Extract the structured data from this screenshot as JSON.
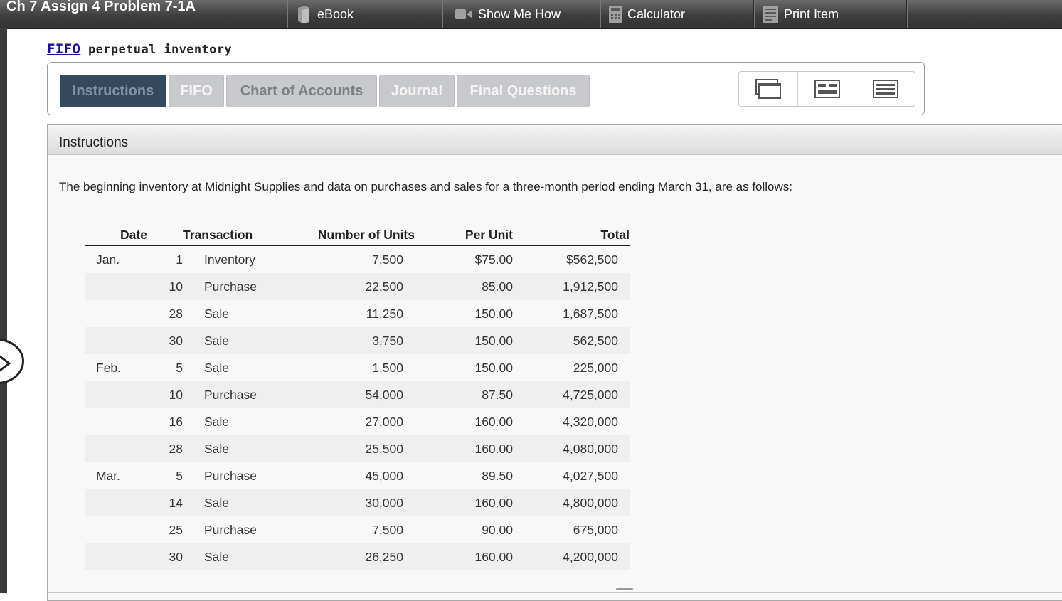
{
  "window": {
    "title": "Ch 7 Assign 4 Problem 7-1A"
  },
  "toolbar": {
    "ebook": "eBook",
    "show_me_how": "Show Me How",
    "calculator": "Calculator",
    "print_item": "Print Item"
  },
  "heading": {
    "link": "FIFO",
    "rest": " perpetual inventory"
  },
  "tabs": [
    {
      "label": "Instructions",
      "active": true
    },
    {
      "label": "FIFO"
    },
    {
      "label": "Chart of Accounts"
    },
    {
      "label": "Journal"
    },
    {
      "label": "Final Questions"
    }
  ],
  "view_buttons": [
    "single-window-icon",
    "split-view-icon",
    "list-view-icon"
  ],
  "panel": {
    "title": "Instructions",
    "intro": "The beginning inventory at Midnight Supplies and data on purchases and sales for a three-month period ending March 31, are as follows:"
  },
  "table": {
    "headers": {
      "date": "Date",
      "transaction": "Transaction",
      "units": "Number of Units",
      "per_unit": "Per Unit",
      "total": "Total"
    },
    "rows": [
      {
        "month": "Jan.",
        "day": "1",
        "transaction": "Inventory",
        "units": "7,500",
        "per_unit": "$75.00",
        "total": "$562,500"
      },
      {
        "month": "",
        "day": "10",
        "transaction": "Purchase",
        "units": "22,500",
        "per_unit": "85.00",
        "total": "1,912,500"
      },
      {
        "month": "",
        "day": "28",
        "transaction": "Sale",
        "units": "11,250",
        "per_unit": "150.00",
        "total": "1,687,500"
      },
      {
        "month": "",
        "day": "30",
        "transaction": "Sale",
        "units": "3,750",
        "per_unit": "150.00",
        "total": "562,500"
      },
      {
        "month": "Feb.",
        "day": "5",
        "transaction": "Sale",
        "units": "1,500",
        "per_unit": "150.00",
        "total": "225,000"
      },
      {
        "month": "",
        "day": "10",
        "transaction": "Purchase",
        "units": "54,000",
        "per_unit": "87.50",
        "total": "4,725,000"
      },
      {
        "month": "",
        "day": "16",
        "transaction": "Sale",
        "units": "27,000",
        "per_unit": "160.00",
        "total": "4,320,000"
      },
      {
        "month": "",
        "day": "28",
        "transaction": "Sale",
        "units": "25,500",
        "per_unit": "160.00",
        "total": "4,080,000"
      },
      {
        "month": "Mar.",
        "day": "5",
        "transaction": "Purchase",
        "units": "45,000",
        "per_unit": "89.50",
        "total": "4,027,500"
      },
      {
        "month": "",
        "day": "14",
        "transaction": "Sale",
        "units": "30,000",
        "per_unit": "160.00",
        "total": "4,800,000"
      },
      {
        "month": "",
        "day": "25",
        "transaction": "Purchase",
        "units": "7,500",
        "per_unit": "90.00",
        "total": "675,000"
      },
      {
        "month": "",
        "day": "30",
        "transaction": "Sale",
        "units": "26,250",
        "per_unit": "160.00",
        "total": "4,200,000"
      }
    ]
  }
}
